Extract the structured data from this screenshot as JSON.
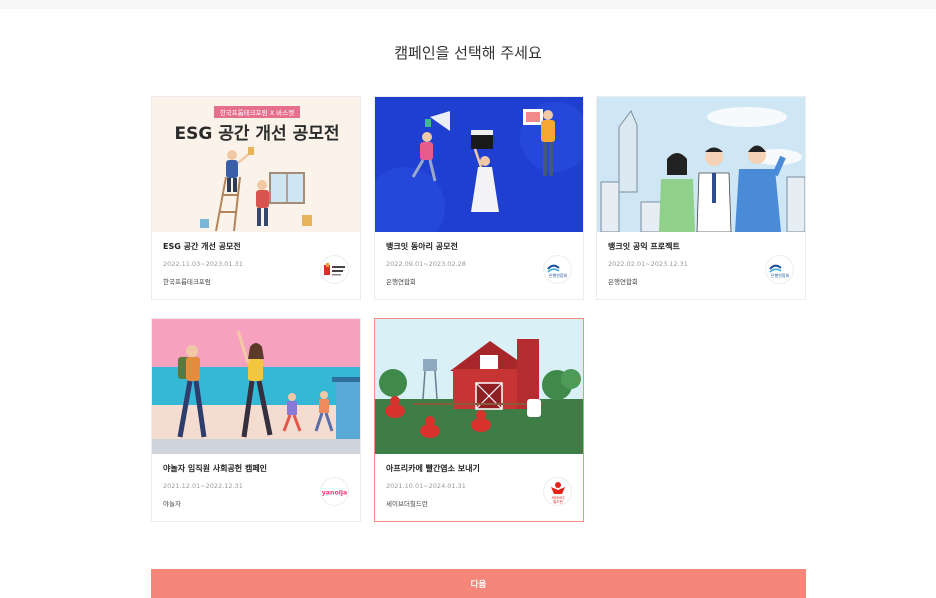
{
  "page": {
    "title": "캠페인을 선택해 주세요",
    "next_label": "다음"
  },
  "campaigns": [
    {
      "title": "ESG 공간 개선 공모전",
      "date": "2022.11.03~2023.01.31",
      "org": "한국프롭테크포럼",
      "banner_tag": "한국프롭테크포럼 X 바스켓",
      "banner_headline": "ESG 공간 개선 공모전",
      "logo_icon": "proptech-forum-logo-icon",
      "selected": false
    },
    {
      "title": "뱅크잇 동아리 공모전",
      "date": "2022.09.01~2023.02.28",
      "org": "은행연합회",
      "logo_icon": "bank-federation-logo-icon",
      "logo_text": "은행연합회",
      "selected": false
    },
    {
      "title": "뱅크잇 공익 프로젝트",
      "date": "2022.02.01~2023.12.31",
      "org": "은행연합회",
      "logo_icon": "bank-federation-logo-icon",
      "logo_text": "은행연합회",
      "selected": false
    },
    {
      "title": "야놀자 임직원 사회공헌 캠페인",
      "date": "2021.12.01~2022.12.31",
      "org": "야놀자",
      "logo_icon": "yanolja-logo-icon",
      "logo_text": "yanolja",
      "selected": false
    },
    {
      "title": "아프리카에 빨간염소 보내기",
      "date": "2021.10.01~2024.01.31",
      "org": "세이브더칠드런",
      "logo_icon": "save-the-children-logo-icon",
      "logo_text": "세이브더\n칠드런",
      "selected": true
    }
  ],
  "colors": {
    "accent": "#f5877a",
    "selected_border": "#f28f7f",
    "yanolja": "#ff3478",
    "save_the_children": "#e2231a",
    "bank_federation": "#1c4f9c"
  }
}
